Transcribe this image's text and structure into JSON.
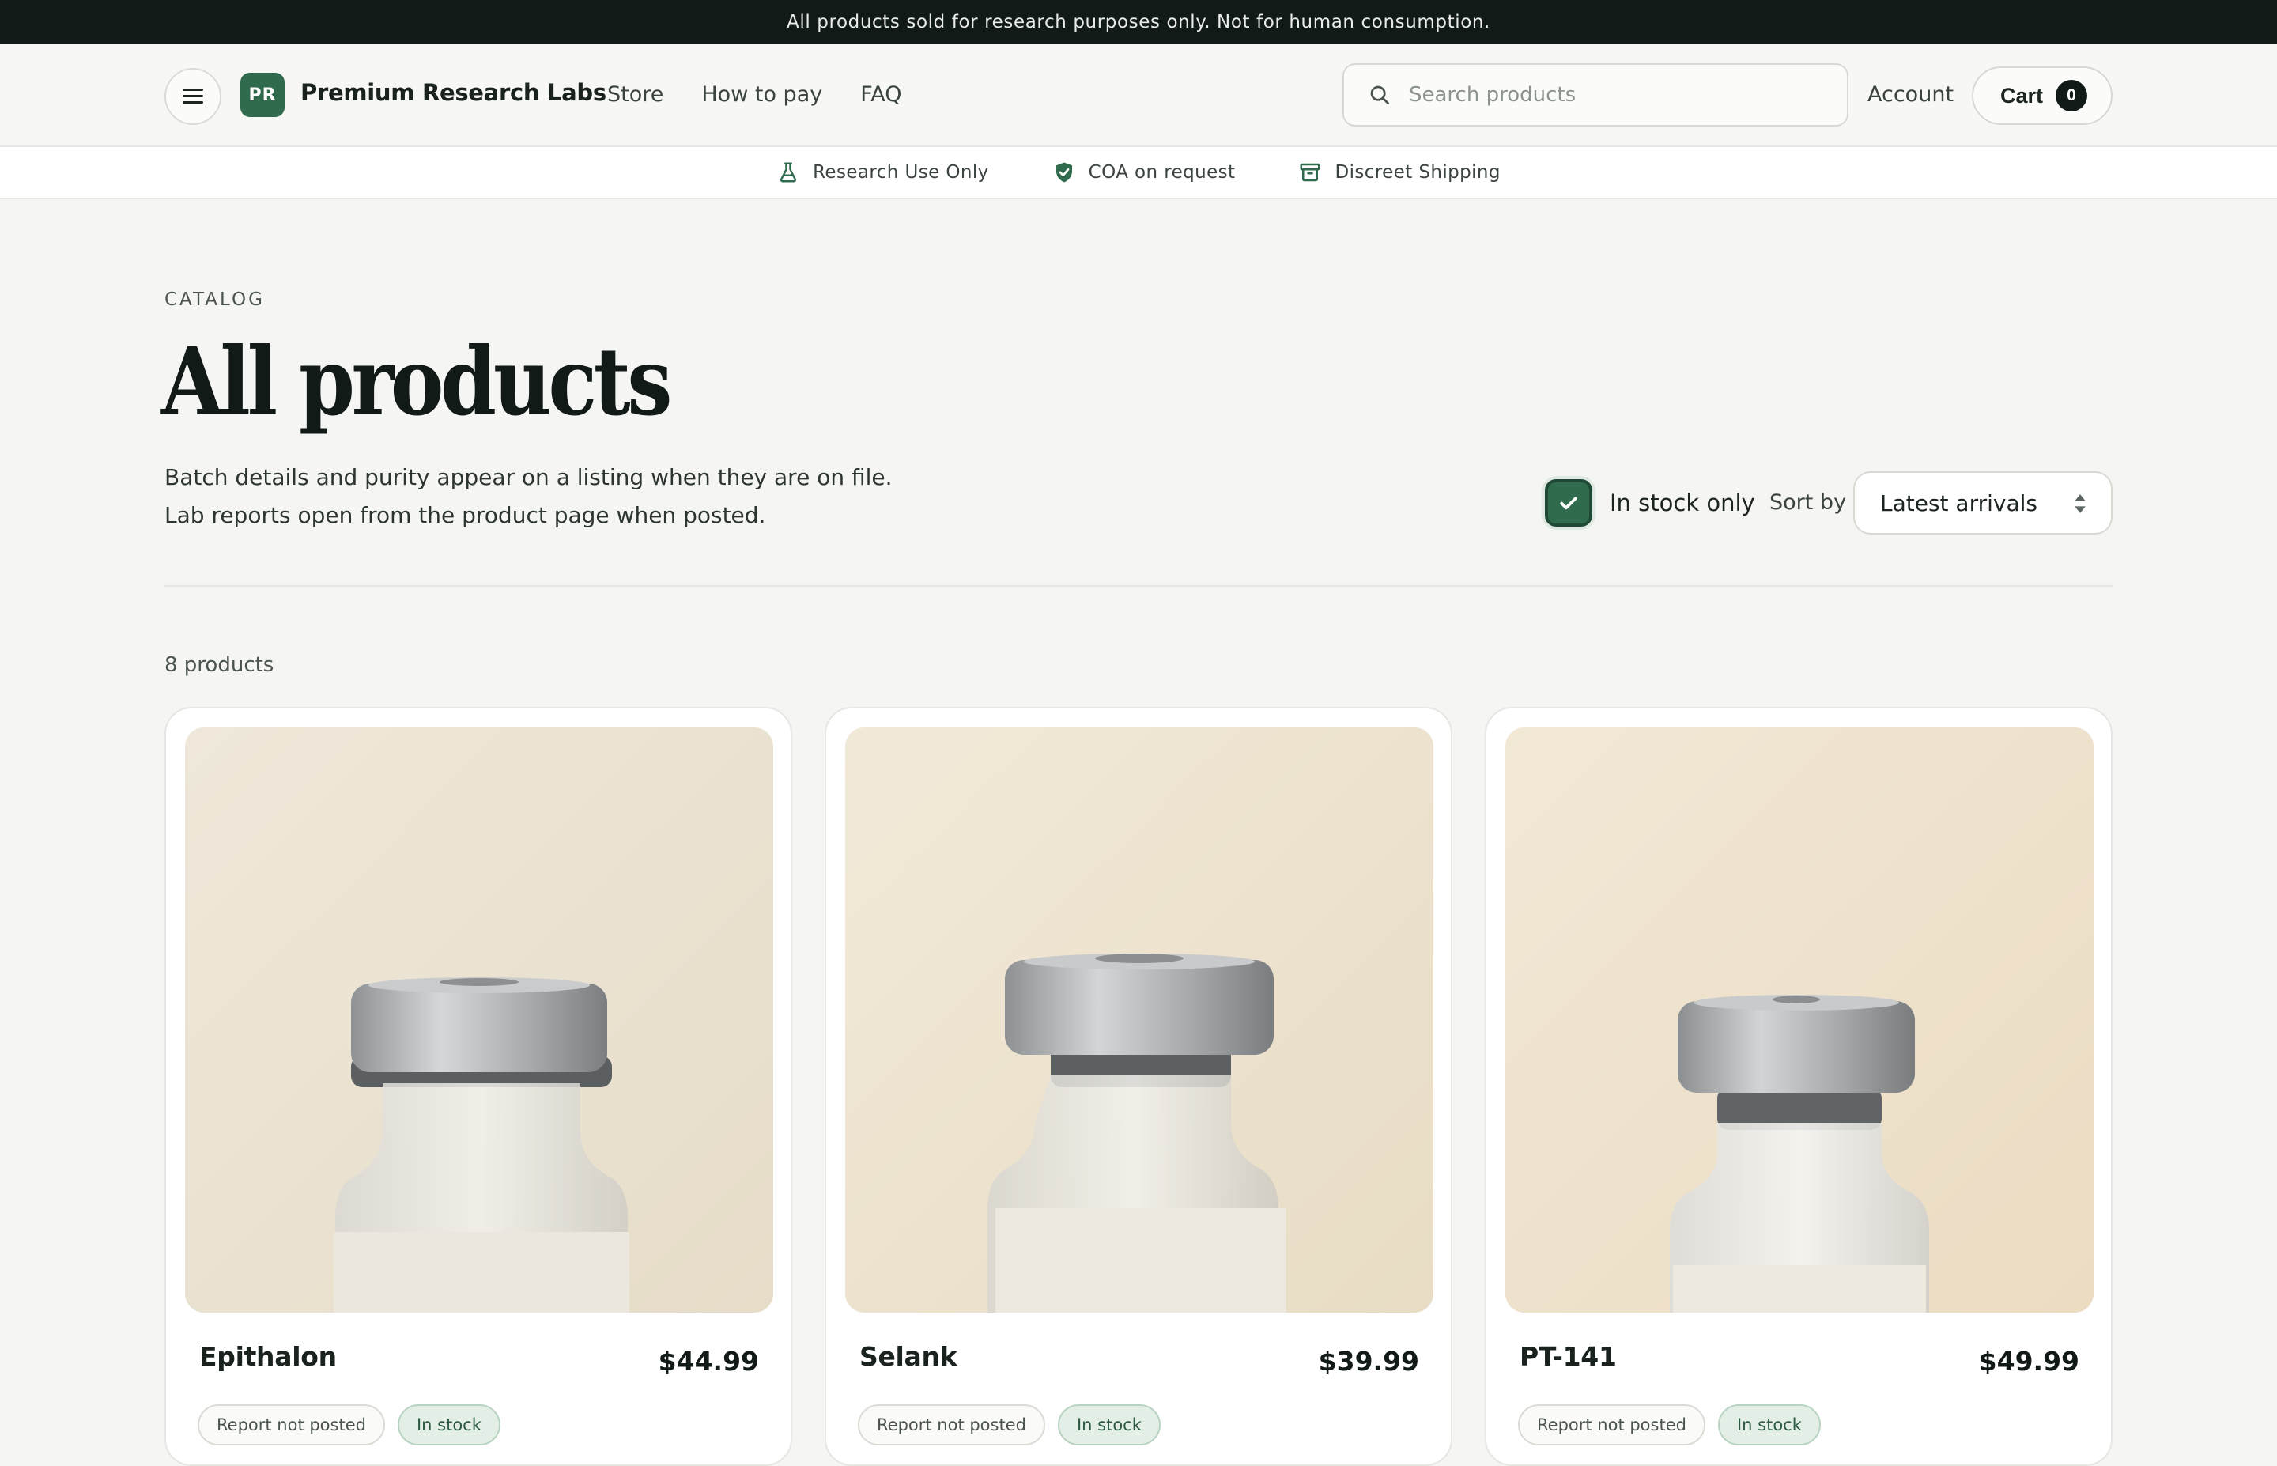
{
  "announcement": "All products sold for research purposes only. Not for human consumption.",
  "header": {
    "logo_initials": "PR",
    "brand": "Premium Research Labs",
    "nav": [
      "Store",
      "How to pay",
      "FAQ"
    ],
    "search_placeholder": "Search products",
    "account": "Account",
    "cart_label": "Cart",
    "cart_count": "0"
  },
  "trust": [
    "Research Use Only",
    "COA on request",
    "Discreet Shipping"
  ],
  "catalog": {
    "eyebrow": "CATALOG",
    "title": "All products",
    "intro": "Batch details and purity appear on a listing when they are on file. Lab reports open from the product page when posted.",
    "in_stock_label": "In stock only",
    "in_stock_checked": true,
    "sort_label": "Sort by",
    "sort_value": "Latest arrivals",
    "count": "8 products"
  },
  "products": [
    {
      "name": "Epithalon",
      "price": "$44.99",
      "report": "Report not posted",
      "stock": "In stock"
    },
    {
      "name": "Selank",
      "price": "$39.99",
      "report": "Report not posted",
      "stock": "In stock"
    },
    {
      "name": "PT-141",
      "price": "$49.99",
      "report": "Report not posted",
      "stock": "In stock"
    }
  ],
  "colors": {
    "brand_green": "#2f6b4c",
    "announcement_bg": "#121a17",
    "page_bg": "#f5f6f3"
  }
}
